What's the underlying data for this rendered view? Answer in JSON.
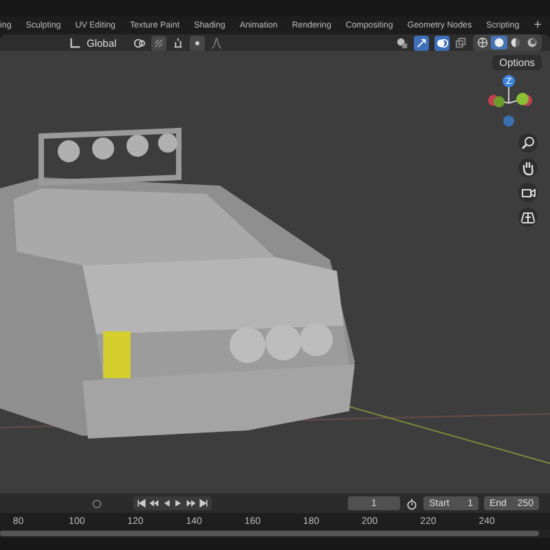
{
  "workspace_tabs": [
    {
      "label": "ing",
      "selected": false
    },
    {
      "label": "Sculpting",
      "selected": false
    },
    {
      "label": "UV Editing",
      "selected": false
    },
    {
      "label": "Texture Paint",
      "selected": false
    },
    {
      "label": "Shading",
      "selected": false
    },
    {
      "label": "Animation",
      "selected": false
    },
    {
      "label": "Rendering",
      "selected": false
    },
    {
      "label": "Compositing",
      "selected": false
    },
    {
      "label": "Geometry Nodes",
      "selected": false
    },
    {
      "label": "Scripting",
      "selected": false
    }
  ],
  "add_tab": "+",
  "header": {
    "orientation": "Global",
    "shading_modes": [
      {
        "kind": "wireframe",
        "selected": false
      },
      {
        "kind": "solid",
        "selected": true
      },
      {
        "kind": "material",
        "selected": false
      },
      {
        "kind": "rendered",
        "selected": false
      }
    ]
  },
  "viewport": {
    "options": "Options",
    "gizmo_label": "Z"
  },
  "timeline": {
    "frame": "1",
    "start_label": "Start",
    "start": "1",
    "end_label": "End",
    "end": "250",
    "ruler": [
      "80",
      "100",
      "120",
      "140",
      "160",
      "180",
      "200",
      "220",
      "240"
    ]
  }
}
